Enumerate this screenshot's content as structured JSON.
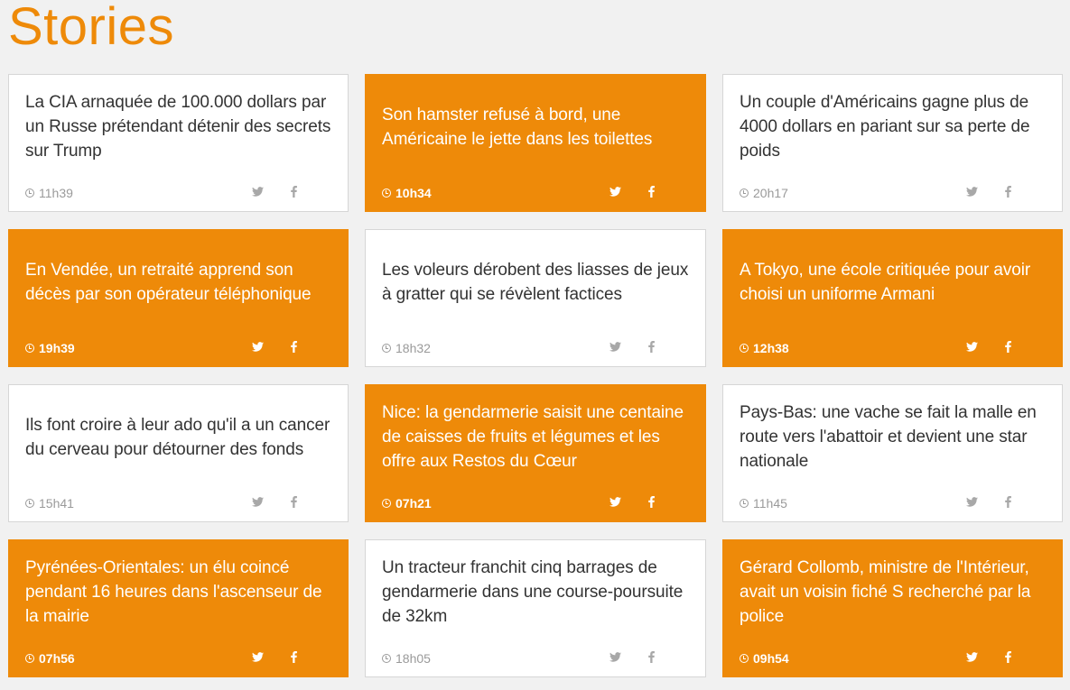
{
  "header": {
    "title": "Stories"
  },
  "colors": {
    "accent": "#ee8a09",
    "card_white": "#ffffff",
    "background": "#f1f1f1",
    "muted": "#9a9a9a"
  },
  "icons": {
    "time": "clock-icon",
    "twitter": "twitter-icon",
    "facebook": "facebook-icon"
  },
  "stories": [
    {
      "title": "La CIA arnaquée de 100.000 dollars par un Russe prétendant détenir des secrets sur Trump",
      "time": "11h39",
      "style": "white"
    },
    {
      "title": "Son hamster refusé à bord, une Américaine le jette dans les toilettes",
      "time": "10h34",
      "style": "orange"
    },
    {
      "title": "Un couple d'Américains gagne plus de 4000 dollars en pariant sur sa perte de poids",
      "time": "20h17",
      "style": "white"
    },
    {
      "title": "En Vendée, un retraité apprend son décès par son opérateur téléphonique",
      "time": "19h39",
      "style": "orange"
    },
    {
      "title": "Les voleurs dérobent des liasses de jeux à gratter qui se révèlent factices",
      "time": "18h32",
      "style": "white"
    },
    {
      "title": "A Tokyo, une école critiquée pour avoir choisi un uniforme Armani",
      "time": "12h38",
      "style": "orange"
    },
    {
      "title": "Ils font croire à leur ado qu'il a un cancer du cerveau pour détourner des fonds",
      "time": "15h41",
      "style": "white"
    },
    {
      "title": "Nice: la gendarmerie saisit une centaine de caisses de fruits et légumes et les offre aux Restos du Cœur",
      "time": "07h21",
      "style": "orange"
    },
    {
      "title": "Pays-Bas: une vache se fait la malle en route vers l'abattoir et devient une star nationale",
      "time": "11h45",
      "style": "white"
    },
    {
      "title": "Pyrénées-Orientales: un élu coincé pendant 16 heures dans l'ascenseur de la mairie",
      "time": "07h56",
      "style": "orange"
    },
    {
      "title": "Un tracteur franchit cinq barrages de gendarmerie dans une course-poursuite de 32km",
      "time": "18h05",
      "style": "white"
    },
    {
      "title": "Gérard Collomb, ministre de l'Intérieur, avait un voisin fiché S recherché par la police",
      "time": "09h54",
      "style": "orange"
    }
  ]
}
